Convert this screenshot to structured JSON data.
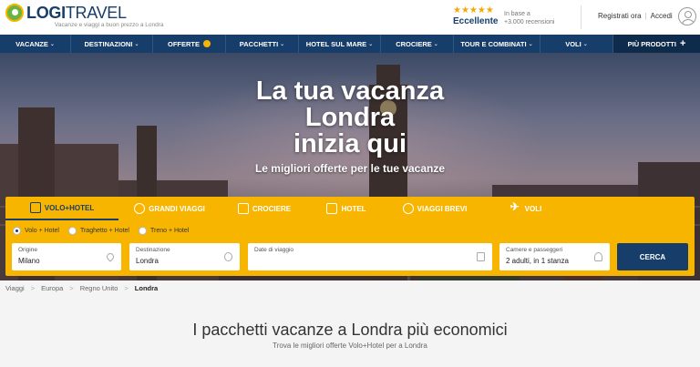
{
  "brand": {
    "name_bold": "LOGI",
    "name_light": "TRAVEL",
    "tagline": "Vacanze e viaggi a buon prezzo a Londra",
    "color_primary": "#173e6b",
    "color_accent": "#f7b500"
  },
  "rating": {
    "stars": "★★★★★",
    "label": "Eccellente",
    "note_line1": "In base a",
    "note_line2": "+3.000 recensioni"
  },
  "auth": {
    "register": "Registrati ora",
    "separator": "|",
    "login": "Accedi"
  },
  "nav": {
    "items": [
      {
        "label": "VACANZE",
        "chev": "⌄"
      },
      {
        "label": "DESTINAZIONI",
        "chev": "⌄"
      },
      {
        "label": "OFFERTE",
        "chev": ""
      },
      {
        "label": "PACCHETTI",
        "chev": "⌄"
      },
      {
        "label": "HOTEL SUL MARE",
        "chev": "⌄"
      },
      {
        "label": "CROCIERE",
        "chev": "⌄"
      },
      {
        "label": "TOUR E COMBINATI",
        "chev": "⌄"
      },
      {
        "label": "VOLI",
        "chev": "⌄"
      },
      {
        "label": "PIÙ PRODOTTI",
        "chev": "+"
      }
    ]
  },
  "hero": {
    "title_line1": "La tua vacanza",
    "title_line2": "Londra",
    "title_line3": "inizia qui",
    "subtitle": "Le migliori offerte per le tue vacanze"
  },
  "search": {
    "tabs": [
      {
        "label": "VOLO+HOTEL",
        "icon": "box-icon"
      },
      {
        "label": "GRANDI VIAGGI",
        "icon": "globe-icon"
      },
      {
        "label": "CROCIERE",
        "icon": "ship-icon"
      },
      {
        "label": "HOTEL",
        "icon": "house-icon"
      },
      {
        "label": "VIAGGI BREVI",
        "icon": "balloon-icon"
      },
      {
        "label": "VOLI",
        "icon": "plane-icon"
      }
    ],
    "options": [
      "Volo + Hotel",
      "Traghetto + Hotel",
      "Treno + Hotel"
    ],
    "selected_option": "Volo + Hotel",
    "origin": {
      "label": "Origine",
      "value": "Milano"
    },
    "destination": {
      "label": "Destinazione",
      "value": "Londra"
    },
    "dates": {
      "label": "Date di viaggio",
      "value": ""
    },
    "rooms": {
      "label": "Camere e passeggeri",
      "value": "2 adulti, in 1 stanza"
    },
    "submit": "CERCA"
  },
  "breadcrumb": {
    "items": [
      "Viaggi",
      "Europa",
      "Regno Unito",
      "Londra"
    ],
    "separator": ">"
  },
  "content": {
    "heading": "I pacchetti vacanze a Londra più economici",
    "subheading": "Trova le migliori offerte Volo+Hotel per a Londra"
  }
}
